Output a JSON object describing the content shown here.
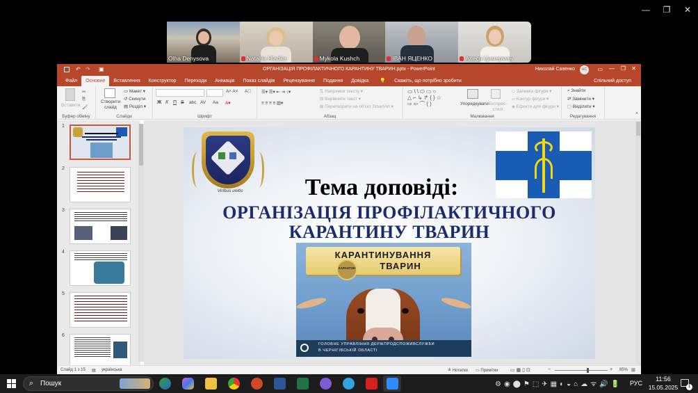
{
  "window_controls": {
    "minimize": "—",
    "restore": "❐",
    "close": "✕"
  },
  "participants": [
    {
      "name": "Olha Denysova",
      "muted": false
    },
    {
      "name": "Nataliia Hladka",
      "muted": true
    },
    {
      "name": "Mykola Kushch",
      "muted": true
    },
    {
      "name": "ІВАН ЯЦЕНКО",
      "muted": true
    },
    {
      "name": "Алеся Цимерман",
      "muted": true
    }
  ],
  "powerpoint": {
    "title": "ОРГАНІЗАЦІЯ ПРОФІЛАКТИЧНОГО КАРАНТИНУ ТВАРИН.pptx  -  PowerPoint",
    "user": "Николай Савенко",
    "user_initials": "НС",
    "tabs": [
      "Файл",
      "Основне",
      "Вставлення",
      "Конструктор",
      "Переходи",
      "Анімація",
      "Показ слайдів",
      "Рецензування",
      "Подання",
      "Довідка"
    ],
    "tell_me": "Скажіть, що потрібно зробити",
    "share": "Спільний доступ",
    "ribbon": {
      "paste": "Вставити",
      "new_slide": "Створити слайд",
      "layout": "Макет",
      "reset": "Скинути",
      "section": "Розділ",
      "text_direction": "Напрямок тексту",
      "align_text": "Вирівняти текст",
      "smartart": "Перетворити на об'єкт SmartArt",
      "arrange": "Упорядкувати",
      "quick_styles": "Експрес-стилі",
      "shape_fill": "Заливка фігури",
      "shape_outline": "Контур фігури",
      "shape_effects": "Ефекти для фігури",
      "find": "Знайти",
      "replace": "Замінити",
      "select": "Виділити",
      "groups": [
        "Буфер обміну",
        "Слайди",
        "Шрифт",
        "Абзац",
        "Малювання",
        "Редагування"
      ],
      "bold": "Ж",
      "italic": "К",
      "underline": "П",
      "strike": "S",
      "shadow": "abc",
      "spacing": "AV",
      "case": "Aa"
    },
    "thumb_numbers": [
      "1",
      "2",
      "3",
      "4",
      "5",
      "6"
    ],
    "slide": {
      "heading": "Тема доповіді:",
      "title_line1": "ОРГАНІЗАЦІЯ ПРОФІЛАКТИЧНОГО",
      "title_line2": "КАРАНТИНУ ТВАРИН",
      "logo_motto": "Viribus unitis",
      "poster_line1": "КАРАНТИНУВАННЯ",
      "poster_line2": "ТВАРИН",
      "poster_stamp": "КАРАНТИН",
      "poster_footer_1": "ГОЛОВНЕ УПРАВЛІННЯ ДЕРЖПРОДСПОЖИВСЛУЖБИ",
      "poster_footer_2": "В ЧЕРНІГІВСЬКІЙ ОБЛАСТІ"
    },
    "status": {
      "slide": "Слайд 1 з 15",
      "language": "українська",
      "notes": "Нотатки",
      "comments": "Примітки",
      "zoom": "85%"
    }
  },
  "taskbar": {
    "search": "Пошук",
    "lang": "РУС",
    "time": "11:56",
    "date": "15.05.2025",
    "notif": "1"
  },
  "colors": {
    "accent": "#b7472a",
    "title_blue": "#1a2c6b",
    "cross_blue": "#1a5bb5",
    "poster_sky": "#6f9dcc"
  }
}
